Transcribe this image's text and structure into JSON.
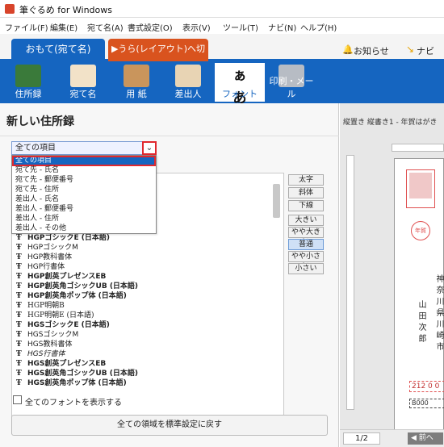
{
  "window": {
    "title": "筆ぐるめ for Windows"
  },
  "menu": [
    "ファイル(F)",
    "編集(E)",
    "宛て名(A)",
    "書式設定(O)",
    "表示(V)",
    "ツール(T)",
    "ナビ(N)",
    "ヘルプ(H)"
  ],
  "mode_tabs": {
    "front": "おもて(宛て名)",
    "back": "▶うら(レイアウト)へ切替"
  },
  "header_links": {
    "notice": "お知らせ",
    "navi": "ナビ"
  },
  "toolbar": [
    {
      "label": "住所録",
      "icon": "address-book-icon"
    },
    {
      "label": "宛て名",
      "icon": "address-label-icon"
    },
    {
      "label": "用 紙",
      "icon": "paper-icon"
    },
    {
      "label": "差出人",
      "icon": "sender-icon"
    },
    {
      "label": "フォント",
      "icon": "font-icon",
      "glyph": "ぁあ"
    },
    {
      "label": "印刷・メール",
      "icon": "printer-icon"
    }
  ],
  "panel": {
    "title": "新しい住所録",
    "combo_value": "全ての項目",
    "dropdown": [
      "全ての項目",
      "宛て先 - 氏名",
      "宛て先 - 郵便番号",
      "宛て先 - 住所",
      "差出人 - 氏名",
      "差出人 - 郵便番号",
      "差出人 - 住所",
      "差出人 - その他"
    ],
    "fonts": [
      "HGPゴシックE (日本語)",
      "HGPゴシックM",
      "HGP教科書体",
      "HGP行書体",
      "HGP創英プレゼンスEB",
      "HGP創英角ゴシックUB (日本語)",
      "HGP創英角ポップ体 (日本語)",
      "HGP明朝B",
      "HGP明朝E (日本語)",
      "HGSゴシックE (日本語)",
      "HGSゴシックM",
      "HGS教科書体",
      "HGS行書体",
      "HGS創英プレゼンスEB",
      "HGS創英角ゴシックUB (日本語)",
      "HGS創英角ポップ体 (日本語)"
    ],
    "style_buttons": [
      "太字",
      "斜体",
      "下線"
    ],
    "size_buttons": [
      "大きい",
      "やや大きい",
      "普通",
      "やや小さい",
      "小さい"
    ],
    "selected_size": "普通",
    "show_all_fonts": "全てのフォントを表示する",
    "reset_button": "全ての領域を標準設定に戻す"
  },
  "preview": {
    "label": "縦置き 縦書き1 - 年賀はがき",
    "name_chars": [
      "山",
      "田",
      "次",
      "郎"
    ],
    "address_chars": "神奈川県川崎市",
    "stamp_text": "年賀",
    "zip": "212 0 0",
    "sender_zip": "B000",
    "page": "1/2",
    "prev": "◀ 前へ"
  },
  "colors": {
    "accent": "#1565c0",
    "highlight": "#e0282e",
    "back_tab": "#d9531e"
  }
}
